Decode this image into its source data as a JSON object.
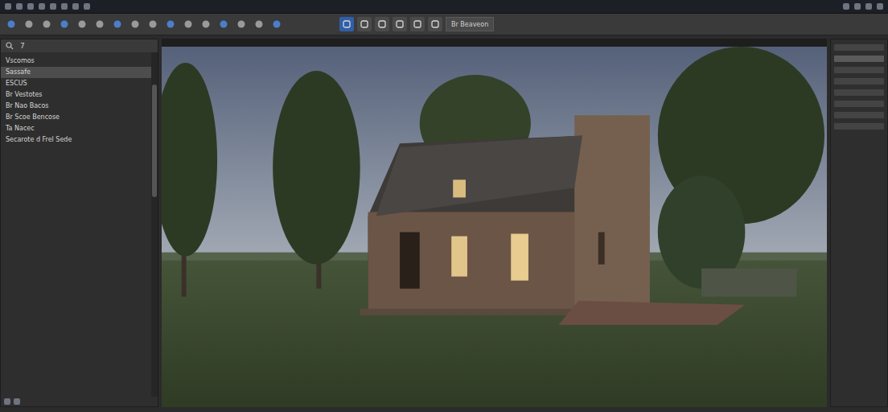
{
  "window": {
    "title": "Br Beaveon"
  },
  "titlebar": {
    "icons": [
      {
        "active": false
      },
      {
        "active": false
      },
      {
        "active": false
      },
      {
        "active": false
      },
      {
        "active": false
      },
      {
        "active": false
      },
      {
        "active": false
      },
      {
        "active": false
      }
    ]
  },
  "toolbar": {
    "tools": [
      {
        "active": false
      },
      {
        "active": false
      },
      {
        "active": false
      },
      {
        "active": false
      },
      {
        "active": false
      },
      {
        "active": false
      },
      {
        "active": false
      },
      {
        "active": false
      },
      {
        "active": false
      },
      {
        "active": false
      },
      {
        "active": false
      },
      {
        "active": false
      },
      {
        "active": false
      },
      {
        "active": false
      },
      {
        "active": false
      },
      {
        "active": false
      }
    ],
    "modes": [
      {
        "active": true
      },
      {
        "active": false
      },
      {
        "active": false
      },
      {
        "active": false
      },
      {
        "active": false
      },
      {
        "active": false
      }
    ],
    "button": {
      "label": "Br Beaveon"
    }
  },
  "left_panel": {
    "header": "7",
    "items": [
      {
        "label": "Vscomos",
        "selected": false
      },
      {
        "label": "Sassafe",
        "selected": true
      },
      {
        "label": "ESCUS",
        "selected": false
      },
      {
        "label": "Br Vestotes",
        "selected": false
      },
      {
        "label": "Br Nao Bacos",
        "selected": false
      },
      {
        "label": "Br Scoe Bencose",
        "selected": false
      },
      {
        "label": "Ta Nacec",
        "selected": false
      },
      {
        "label": "Secarote d Frel Sede",
        "selected": false
      }
    ]
  },
  "right_panel": {
    "rows": [
      {
        "selected": false
      },
      {
        "selected": true
      },
      {
        "selected": false
      },
      {
        "selected": false
      },
      {
        "selected": false
      },
      {
        "selected": false
      },
      {
        "selected": false
      },
      {
        "selected": false
      }
    ]
  }
}
